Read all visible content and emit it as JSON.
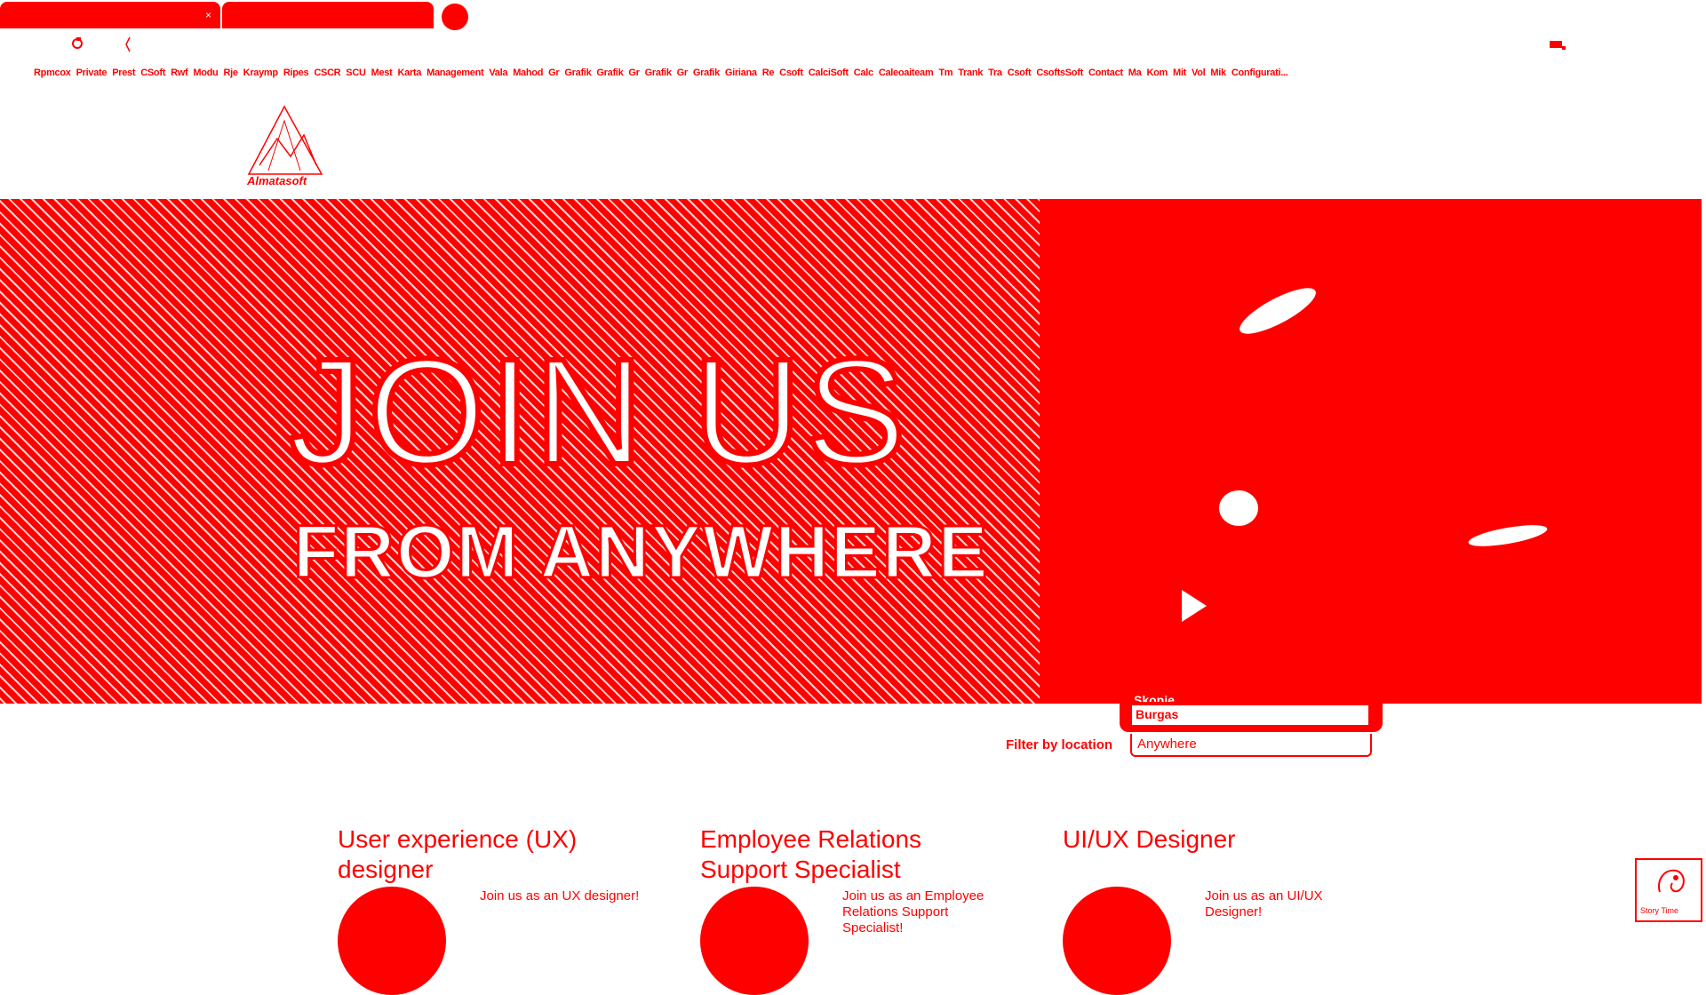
{
  "browser": {
    "tabs": [
      {
        "title": "",
        "close": "×"
      },
      {
        "title": ""
      }
    ],
    "bookmarks": [
      "Rpmcox",
      "Private",
      "Prest",
      "CSoft",
      "Rwf",
      "Modu",
      "Rje",
      "Kraymp",
      "Ripes",
      "CSCR",
      "SCU",
      "Mest",
      "Karta",
      "Management",
      "Vala",
      "Mahod",
      "Gr",
      "Grafik",
      "Grafik",
      "Gr",
      "Grafik",
      "Gr",
      "Grafik",
      "Giriana",
      "Re",
      "Csoft",
      "CalciSoft",
      "Calc",
      "Caleoaiteam",
      "Tm",
      "Trank",
      "Tra",
      "Csoft",
      "CsoftsSoft",
      "Contact",
      "Ma",
      "Kom",
      "Mit",
      "Vol",
      "Mik",
      "Configurati..."
    ]
  },
  "site": {
    "logo_text": "Almatasoft"
  },
  "hero": {
    "title": "JOIN US",
    "subtitle": "FROM ANYWHERE"
  },
  "location_dropdown": {
    "options": [
      "Skopje",
      "Burgas"
    ],
    "highlighted": "Burgas"
  },
  "filter": {
    "label": "Filter by location",
    "value": "Anywhere"
  },
  "jobs": [
    {
      "title": "User experience (UX) designer",
      "description": "Join us as an UX designer!"
    },
    {
      "title": "Employee Relations Support Specialist",
      "description": "Join us as an Employee Relations Support Specialist!"
    },
    {
      "title": "UI/UX Designer",
      "description": "Join us as an UI/UX Designer!"
    }
  ],
  "widget": {
    "label": "Story Time"
  },
  "colors": {
    "accent": "#ff0000",
    "background": "#ffffff"
  }
}
